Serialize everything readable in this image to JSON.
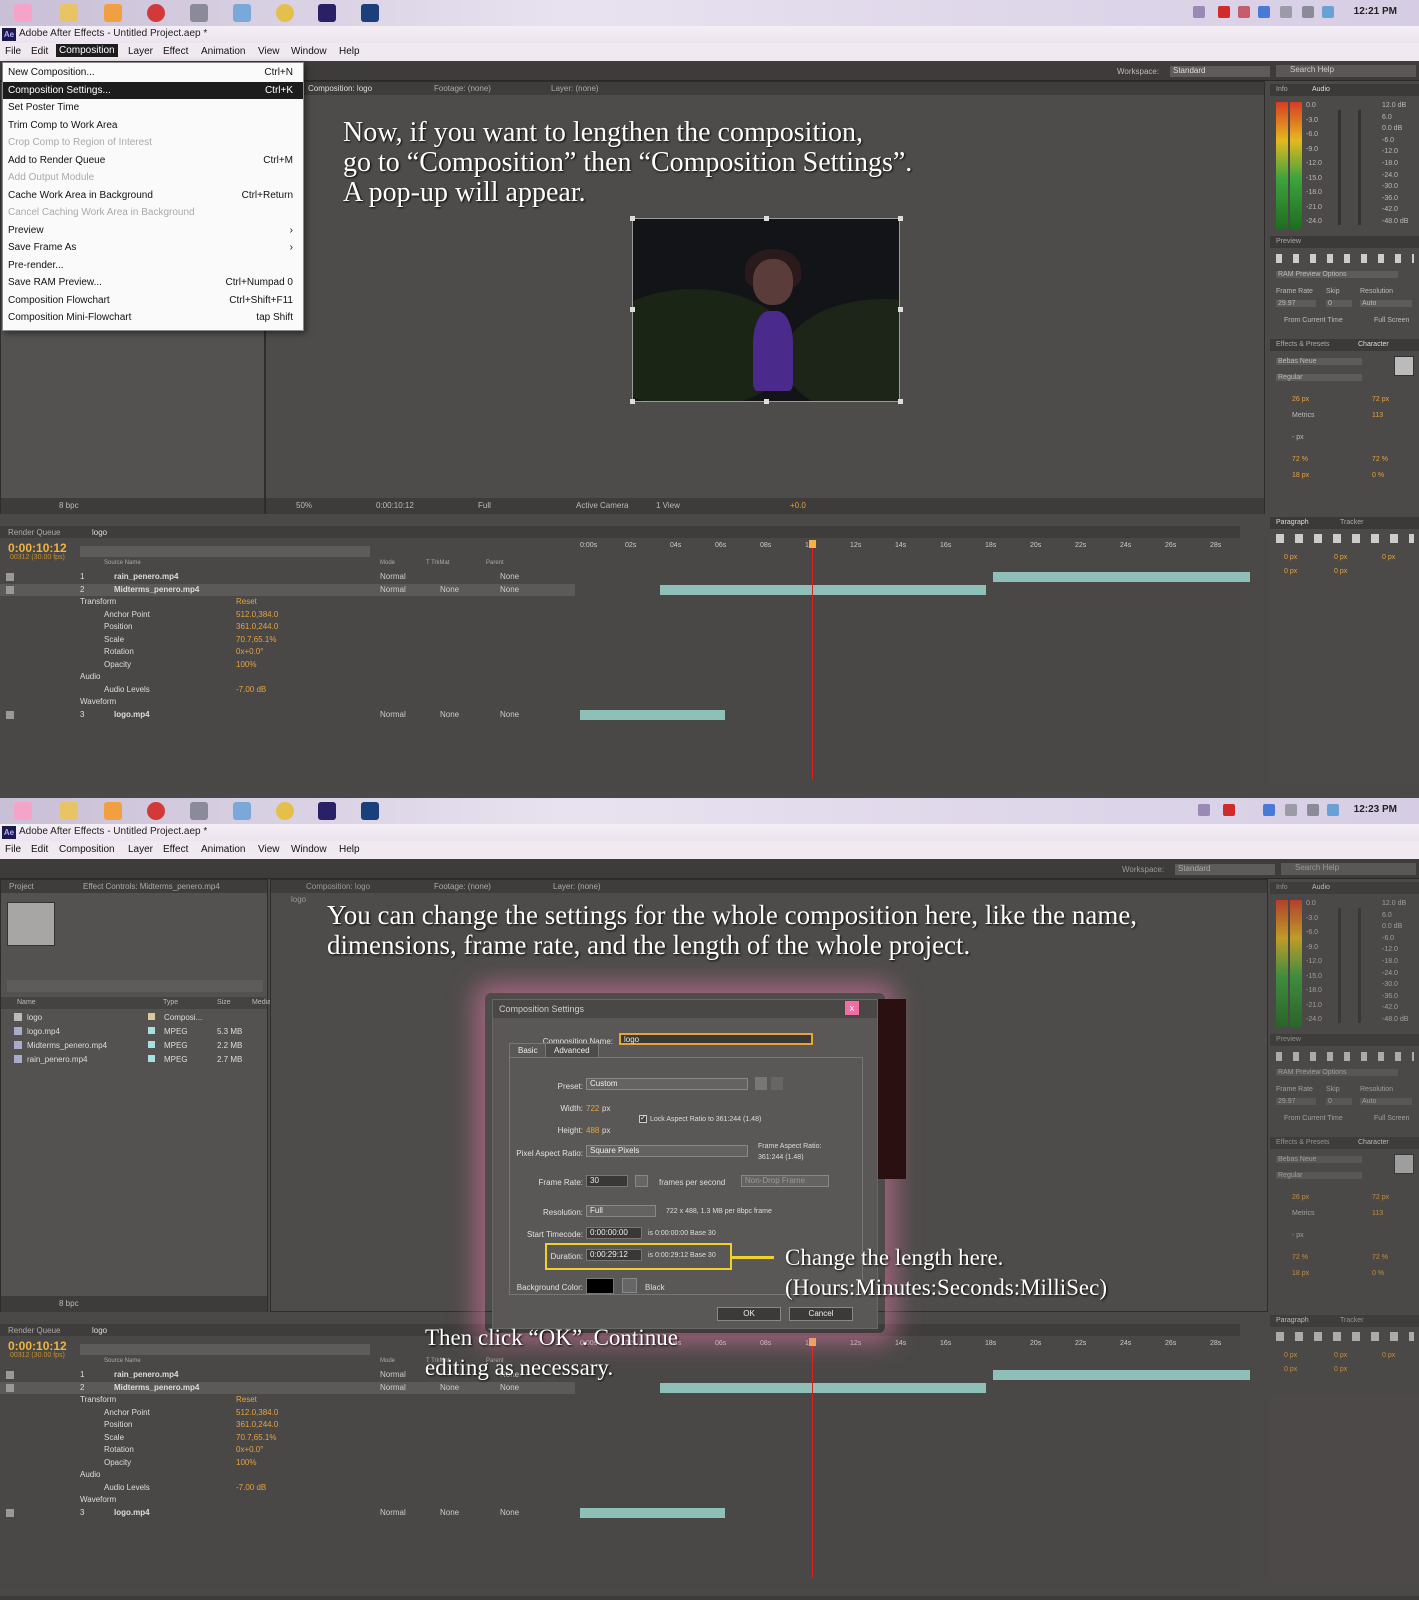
{
  "shot1": {
    "clock": "12:21 PM",
    "window_title": "Adobe After Effects - Untitled Project.aep *",
    "menu": [
      "File",
      "Edit",
      "Composition",
      "Layer",
      "Effect",
      "Animation",
      "View",
      "Window",
      "Help"
    ],
    "active_menu": "Composition",
    "dropdown": [
      {
        "label": "New Composition...",
        "shortcut": "Ctrl+N",
        "state": "normal"
      },
      {
        "label": "Composition Settings...",
        "shortcut": "Ctrl+K",
        "state": "highlighted"
      },
      {
        "label": "Set Poster Time",
        "shortcut": "",
        "state": "normal"
      },
      {
        "label": "Trim Comp to Work Area",
        "shortcut": "",
        "state": "normal"
      },
      {
        "label": "Crop Comp to Region of Interest",
        "shortcut": "",
        "state": "disabled"
      },
      {
        "label": "Add to Render Queue",
        "shortcut": "Ctrl+M",
        "state": "normal"
      },
      {
        "label": "Add Output Module",
        "shortcut": "",
        "state": "disabled"
      },
      {
        "label": "Cache Work Area in Background",
        "shortcut": "Ctrl+Return",
        "state": "normal"
      },
      {
        "label": "Cancel Caching Work Area in Background",
        "shortcut": "",
        "state": "disabled"
      },
      {
        "label": "Preview",
        "shortcut": "›",
        "state": "normal"
      },
      {
        "label": "Save Frame As",
        "shortcut": "›",
        "state": "normal"
      },
      {
        "label": "Pre-render...",
        "shortcut": "",
        "state": "normal"
      },
      {
        "label": "Save RAM Preview...",
        "shortcut": "Ctrl+Numpad 0",
        "state": "normal"
      },
      {
        "label": "Composition Flowchart",
        "shortcut": "Ctrl+Shift+F11",
        "state": "normal"
      },
      {
        "label": "Composition Mini-Flowchart",
        "shortcut": "tap Shift",
        "state": "normal"
      }
    ],
    "workspace_label": "Workspace:",
    "workspace_value": "Standard",
    "search_help": "Search Help",
    "viewer_tabs": [
      "Composition: logo",
      "Footage: (none)",
      "Layer: (none)"
    ],
    "caption": [
      "Now, if you want to lengthen the composition,",
      "go to “Composition” then “Composition Settings”.",
      "A pop-up will appear."
    ],
    "viewer_footer": {
      "zoom": "50%",
      "time": "0:00:10:12",
      "resolution": "Full",
      "camera": "Active Camera",
      "view": "1 View",
      "exposure": "+0.0"
    },
    "project_footer": "8 bpc"
  },
  "shot2": {
    "clock": "12:23 PM",
    "window_title": "Adobe After Effects - Untitled Project.aep *",
    "menu": [
      "File",
      "Edit",
      "Composition",
      "Layer",
      "Effect",
      "Animation",
      "View",
      "Window",
      "Help"
    ],
    "workspace_label": "Workspace:",
    "workspace_value": "Standard",
    "search_help": "Search Help",
    "project_tabs": [
      "Project",
      "Effect Controls: Midterms_penero.mp4"
    ],
    "viewer_tabs": [
      "Composition: logo",
      "Footage: (none)",
      "Layer: (none)"
    ],
    "viewer_subtab": "logo",
    "project_columns": [
      "Name",
      "Type",
      "Size",
      "Media"
    ],
    "project_items": [
      {
        "name": "logo",
        "type": "Composi...",
        "size": ""
      },
      {
        "name": "logo.mp4",
        "type": "MPEG",
        "size": "5.3 MB"
      },
      {
        "name": "Midterms_penero.mp4",
        "type": "MPEG",
        "size": "2.2 MB"
      },
      {
        "name": "rain_penero.mp4",
        "type": "MPEG",
        "size": "2.7 MB"
      }
    ],
    "caption": [
      "You can change the settings for the whole composition here, like the name,",
      "dimensions, frame rate, and the length of the whole project."
    ],
    "callout": [
      "Change the length here.",
      "(Hours:Minutes:Seconds:MilliSec)"
    ],
    "bottom_caption": [
      "Then click “OK”. Continue",
      "editing as necessary."
    ],
    "dialog": {
      "title": "Composition Settings",
      "close": "x",
      "name_label": "Composition Name:",
      "name_value": "logo",
      "tabs": [
        "Basic",
        "Advanced"
      ],
      "preset_label": "Preset:",
      "preset_value": "Custom",
      "width_label": "Width:",
      "width_value": "722",
      "height_label": "Height:",
      "height_value": "488",
      "px": "px",
      "lock_label": "Lock Aspect Ratio to 361:244 (1.48)",
      "par_label": "Pixel Aspect Ratio:",
      "par_value": "Square Pixels",
      "far_label": "Frame Aspect Ratio:",
      "far_value": "361:244 (1.48)",
      "fps_label": "Frame Rate:",
      "fps_value": "30",
      "fps_unit": "frames per second",
      "drop_frame": "Non-Drop Frame",
      "res_label": "Resolution:",
      "res_value": "Full",
      "res_info": "722 x 488, 1.3 MB per 8bpc frame",
      "start_label": "Start Timecode:",
      "start_value": "0:00:00:00",
      "start_info": "is 0:00:00:00  Base 30",
      "dur_label": "Duration:",
      "dur_value": "0:00:29:12",
      "dur_info": "is 0:00:29:12  Base 30",
      "bg_label": "Background Color:",
      "bg_value": "Black",
      "ok": "OK",
      "cancel": "Cancel"
    },
    "project_footer": "8 bpc"
  },
  "timeline": {
    "tabs": [
      "Render Queue",
      "logo"
    ],
    "time": "0:00:10:12",
    "fps": "00312 (30.00 fps)",
    "columns": [
      "Source Name",
      "Mode",
      "T TrkMat",
      "Parent"
    ],
    "ruler": [
      "0:00s",
      "02s",
      "04s",
      "06s",
      "08s",
      "10s",
      "12s",
      "14s",
      "16s",
      "18s",
      "20s",
      "22s",
      "24s",
      "26s",
      "28s"
    ],
    "rows": [
      {
        "num": "1",
        "name": "rain_penero.mp4",
        "mode": "Normal",
        "trkmat": "",
        "parent": "None",
        "kind": "layer"
      },
      {
        "num": "2",
        "name": "Midterms_penero.mp4",
        "mode": "Normal",
        "trkmat": "None",
        "parent": "None",
        "kind": "layer-sel"
      },
      {
        "name": "Transform",
        "value": "Reset",
        "kind": "group"
      },
      {
        "name": "Anchor Point",
        "value": "512.0,384.0",
        "kind": "prop"
      },
      {
        "name": "Position",
        "value": "361.0,244.0",
        "kind": "prop"
      },
      {
        "name": "Scale",
        "value": "70.7,65.1%",
        "kind": "prop"
      },
      {
        "name": "Rotation",
        "value": "0x+0.0°",
        "kind": "prop"
      },
      {
        "name": "Opacity",
        "value": "100%",
        "kind": "prop"
      },
      {
        "name": "Audio",
        "value": "",
        "kind": "group"
      },
      {
        "name": "Audio Levels",
        "value": "-7.00 dB",
        "kind": "prop"
      },
      {
        "name": "Waveform",
        "value": "",
        "kind": "group"
      },
      {
        "num": "3",
        "name": "logo.mp4",
        "mode": "Normal",
        "trkmat": "None",
        "parent": "None",
        "kind": "layer"
      }
    ]
  },
  "right_panel": {
    "info_tabs": [
      "Info",
      "Audio"
    ],
    "db_left": [
      "0.0",
      "-3.0",
      "-6.0",
      "-9.0",
      "-12.0",
      "-15.0",
      "-18.0",
      "-21.0",
      "-24.0"
    ],
    "db_right": [
      "12.0 dB",
      "6.0",
      "0.0 dB",
      "-6.0",
      "-12.0",
      "-18.0",
      "-24.0",
      "-30.0",
      "-36.0",
      "-42.0",
      "-48.0 dB"
    ],
    "preview_tab": "Preview",
    "ram_options": "RAM Preview Options",
    "frame_rate_label": "Frame Rate",
    "skip_label": "Skip",
    "resolution_label": "Resolution",
    "frame_rate_value": "29.97",
    "skip_value": "0",
    "resolution_value": "Auto",
    "from_current": "From Current Time",
    "full_screen": "Full Screen",
    "effects_tab": "Effects & Presets",
    "character_tab": "Character",
    "font": "Bebas Neue",
    "style": "Regular",
    "size": "26 px",
    "leading": "72 px",
    "kerning": "Metrics",
    "tracking": "113",
    "stroke": "- px",
    "v_scale": "72 %",
    "h_scale": "72 %",
    "baseline": "18 px",
    "tsume": "0 %",
    "paragraph_tab": "Paragraph",
    "tracker_tab": "Tracker",
    "indent": "0 px"
  },
  "colors": {
    "accent_orange": "#e7a23c",
    "panel": "#545250",
    "highlight": "#f0d02a",
    "dialog_glow": "#e678aa"
  }
}
